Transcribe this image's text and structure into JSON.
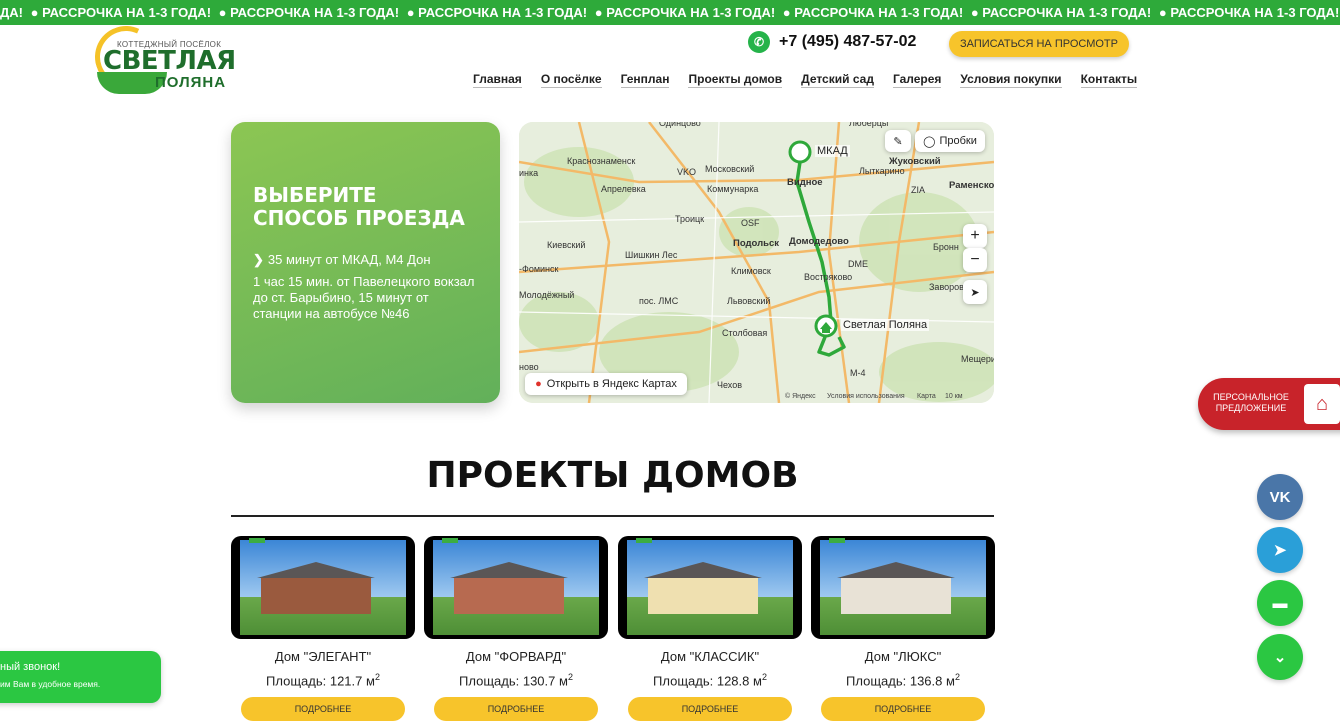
{
  "ticker": {
    "text": "● РАССРОЧКА НА 1-3 ГОДА!",
    "repeat_prefix": "ДА!"
  },
  "logo": {
    "small_top": "КОТТЕДЖНЫЙ ПОСЁЛОК",
    "big": "СВЕТЛАЯ",
    "bottom": "ПОЛЯНА"
  },
  "header": {
    "phone": "+7 (495) 487-57-02",
    "cta": "ЗАПИСАТЬСЯ НА ПРОСМОТР",
    "nav": [
      "Главная",
      "О посёлке",
      "Генплан",
      "Проекты домов",
      "Детский сад",
      "Галерея",
      "Условия покупки",
      "Контакты"
    ]
  },
  "route": {
    "title": "ВЫБЕРИТЕ СПОСОБ ПРОЕЗДА",
    "line1": "35 минут от МКАД, М4 Дон",
    "line2": "1 час 15 мин. от Павелецкого вокзал до ст. Барыбино, 15 минут от станции на автобусе №46"
  },
  "map": {
    "mkad_label": "МКАД",
    "dest_label": "Светлая Поляна",
    "traffic_label": "Пробки",
    "open_label": "Открыть в Яндекс Картах",
    "footer_yandex": "© Яндекс",
    "footer_terms": "Условия использования",
    "footer_scale": "10 км",
    "footer_maps": "Карта",
    "zoom_in": "+",
    "zoom_out": "−",
    "places": [
      "Одинцово",
      "Люберцы",
      "Краснознаменск",
      "Московский",
      "Видное",
      "Лыткарино",
      "Жуковский",
      "Раменское",
      "инка",
      "Апрелевка",
      "Коммунарка",
      "Троицк",
      "Домодедово",
      "Бронн",
      "Киевский",
      "Подольск",
      "Шишкин Лес",
      "Климовск",
      "Востряково",
      "-Фоминск",
      "Молодёжный",
      "пос. ЛМС",
      "Львовский",
      "Заворово",
      "Столбовая",
      "Мещери",
      "ново",
      "Чехов",
      "VKO",
      "OSF",
      "DME",
      "ZIA",
      "М-4"
    ]
  },
  "promo": {
    "text": "ПЕРСОНАЛЬНОЕ ПРЕДЛОЖЕНИЕ"
  },
  "projects": {
    "title": "ПРОЕКТЫ ДОМОВ",
    "more_label": "ПОДРОБНЕЕ",
    "area_prefix": "Площадь:",
    "area_unit": "м",
    "items": [
      {
        "name": "Дом \"ЭЛЕГАНТ\"",
        "area": "121.7",
        "wall_color": "#9a5a3e"
      },
      {
        "name": "Дом \"ФОРВАРД\"",
        "area": "130.7",
        "wall_color": "#b76a50"
      },
      {
        "name": "Дом \"КЛАССИК\"",
        "area": "128.8",
        "wall_color": "#efe0b0"
      },
      {
        "name": "Дом \"ЛЮКС\"",
        "area": "136.8",
        "wall_color": "#e8e2d6"
      }
    ]
  },
  "social": [
    {
      "name": "vk",
      "label": "VK",
      "color": "#4a76a8"
    },
    {
      "name": "telegram",
      "label": "➤",
      "color": "#2a9fd8"
    },
    {
      "name": "chat",
      "label": "▬",
      "color": "#2bc742"
    },
    {
      "name": "expand",
      "label": "⌄",
      "color": "#2bc742"
    }
  ],
  "callback": {
    "title": "ный звонок!",
    "subtitle": "им Вам в удобное время."
  }
}
